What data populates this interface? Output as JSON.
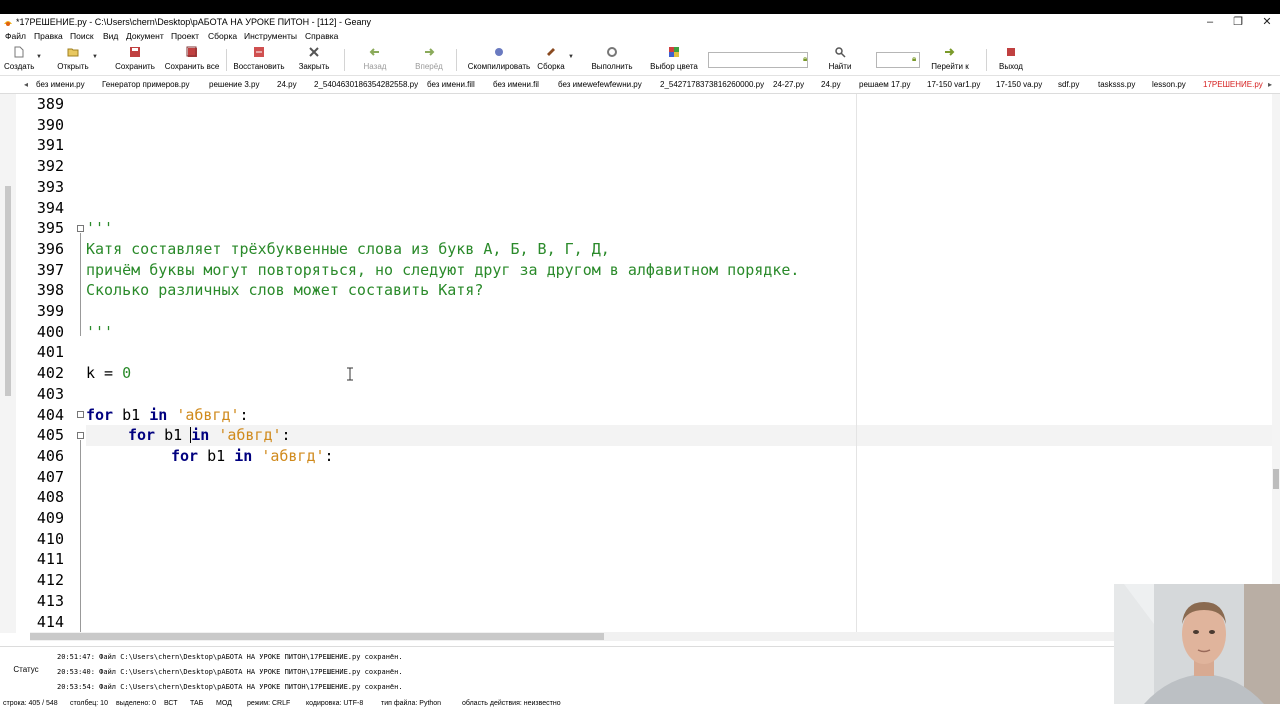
{
  "window": {
    "title": "*17РЕШЕНИЕ.py - C:\\Users\\chern\\Desktop\\рАБОТА НА УРОКЕ ПИТОН - [112] - Geany",
    "minimize": "–",
    "maximize": "❐",
    "close": "✕"
  },
  "menu": [
    "Файл",
    "Правка",
    "Поиск",
    "Вид",
    "Документ",
    "Проект",
    "Сборка",
    "Инструменты",
    "Справка"
  ],
  "toolbar": {
    "new": "Создать",
    "open": "Открыть",
    "save": "Сохранить",
    "save_all": "Сохранить все",
    "revert": "Восстановить",
    "close": "Закрыть",
    "back": "Назад",
    "forward": "Вперёд",
    "compile": "Скомпилировать",
    "build": "Сборка",
    "run": "Выполнить",
    "color": "Выбор цвета",
    "find": "Найти",
    "goto": "Перейти к",
    "quit": "Выход",
    "search_value": "",
    "goto_value": ""
  },
  "tabs": [
    "без имени.py",
    "Генератор примеров.py",
    "решение 3.py",
    "24.py",
    "2_5404630186354282558.py",
    "без имени.fill",
    "без имени.fil",
    "без имеwefewfewни.py",
    "2_5427178373816260000.py",
    "24-27.py",
    "24.py",
    "решаем 17.py",
    "17-150 var1.py",
    "17-150 va.py",
    "sdf.py",
    "tasksss.py",
    "lesson.py",
    "17РЕШЕНИЕ.py"
  ],
  "active_tab": "17РЕШЕНИЕ.py",
  "editor": {
    "line_numbers": [
      "389",
      "390",
      "391",
      "392",
      "393",
      "394",
      "395",
      "396",
      "397",
      "398",
      "399",
      "400",
      "401",
      "402",
      "403",
      "404",
      "405",
      "406",
      "407",
      "408",
      "409",
      "410",
      "411",
      "412",
      "413",
      "414"
    ],
    "lines": {
      "l395": "'''",
      "l396": "Катя составляет трёхбуквенные слова из букв А, Б, В, Г, Д,",
      "l397": "причём буквы могут повторяться, но следуют друг за другом в алфавитном порядке.",
      "l398": "Сколько различных слов может составить Катя?",
      "l400": "'''",
      "l402_var": "k",
      "l402_op": " = ",
      "l402_num": "0",
      "kw_for": "for",
      "kw_in": "in",
      "var_b1": " b1 ",
      "str_abvgd": "'абвгд'",
      "colon": ":"
    }
  },
  "messages": {
    "tab_label": "Статус",
    "lines": [
      "20:51:47: Файл C:\\Users\\chern\\Desktop\\рАБОТА НА УРОКЕ ПИТОН\\17РЕШЕНИЕ.py сохранён.",
      "20:53:40: Файл C:\\Users\\chern\\Desktop\\рАБОТА НА УРОКЕ ПИТОН\\17РЕШЕНИЕ.py сохранён.",
      "20:53:54: Файл C:\\Users\\chern\\Desktop\\рАБОТА НА УРОКЕ ПИТОН\\17РЕШЕНИЕ.py сохранён."
    ]
  },
  "status": {
    "position": "строка: 405 / 548",
    "column": "столбец: 10",
    "selected": "выделено: 0",
    "mode": "ВСТ",
    "tab": "ТАБ",
    "mod": "МОД",
    "eol": "режим: CRLF",
    "encoding": "кодировка: UTF-8",
    "filetype": "тип файла: Python",
    "scope": "область действия: неизвестно"
  },
  "colors": {
    "keyword": "#00007f",
    "string": "#d08a1c",
    "docstring": "#2a8a2a",
    "active_tab": "#d62020"
  }
}
